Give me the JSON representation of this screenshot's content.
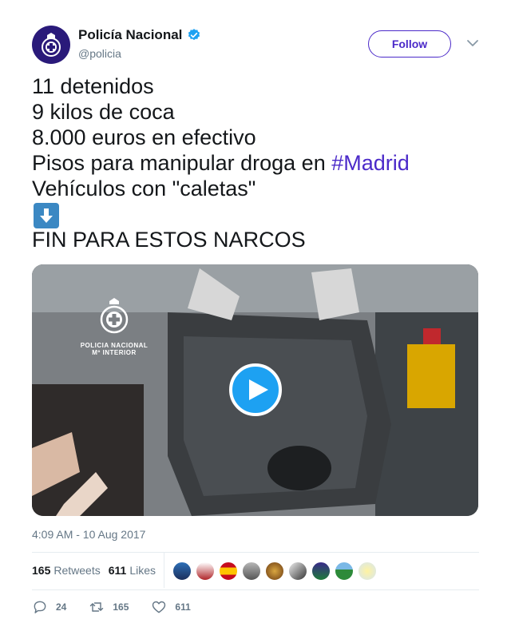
{
  "account": {
    "name": "Policía Nacional",
    "handle": "@policia",
    "avatar_color": "#2a1a7a"
  },
  "follow_label": "Follow",
  "tweet": {
    "lines": [
      "11 detenidos",
      "9 kilos de coca",
      "8.000 euros en efectivo",
      "Pisos para manipular droga en "
    ],
    "hashtag": "#Madrid",
    "line5": "Vehículos con \"caletas\"",
    "arrow_emoji": "down-arrow-emoji",
    "line7": "FIN PARA ESTOS NARCOS"
  },
  "media": {
    "watermark_line1": "POLICIA NACIONAL",
    "watermark_line2": "Mº INTERIOR",
    "play_icon": "play-icon"
  },
  "timestamp": "4:09 AM - 10 Aug 2017",
  "stats": {
    "retweets_count": "165",
    "retweets_label": "Retweets",
    "likes_count": "611",
    "likes_label": "Likes"
  },
  "actions": {
    "reply_count": "24",
    "retweet_count": "165",
    "like_count": "611"
  },
  "colors": {
    "accent": "#4b2ac9",
    "play": "#1da1f2",
    "muted": "#657786"
  }
}
